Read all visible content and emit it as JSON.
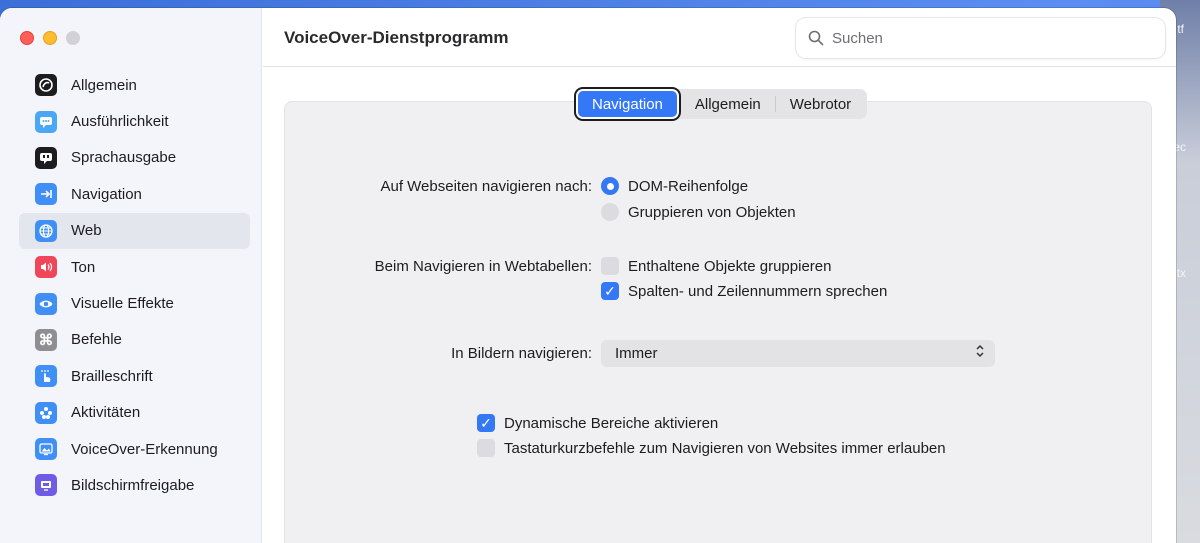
{
  "desktop": {
    "labels": [
      "tf",
      "ec",
      "tx"
    ]
  },
  "window": {
    "title": "VoiceOver-Dienstprogramm"
  },
  "search": {
    "placeholder": "Suchen"
  },
  "sidebar": {
    "items": [
      {
        "label": "Allgemein",
        "icon": "voiceover-icon",
        "color": "#1d1d1f"
      },
      {
        "label": "Ausführlichkeit",
        "icon": "speech-bubble-icon",
        "color": "#4aa7f5"
      },
      {
        "label": "Sprachausgabe",
        "icon": "speech-icon",
        "color": "#1d1d1f"
      },
      {
        "label": "Navigation",
        "icon": "arrow-right-icon",
        "color": "#3f8ff7"
      },
      {
        "label": "Web",
        "icon": "globe-icon",
        "color": "#3f8ff7",
        "selected": true
      },
      {
        "label": "Ton",
        "icon": "speaker-icon",
        "color": "#f0465a"
      },
      {
        "label": "Visuelle Effekte",
        "icon": "eye-icon",
        "color": "#3f8ff7"
      },
      {
        "label": "Befehle",
        "icon": "command-icon",
        "color": "#8e8e93"
      },
      {
        "label": "Brailleschrift",
        "icon": "braille-hand-icon",
        "color": "#3f8ff7"
      },
      {
        "label": "Aktivitäten",
        "icon": "activities-icon",
        "color": "#3f8ff7"
      },
      {
        "label": "VoiceOver-Erkennung",
        "icon": "recognition-icon",
        "color": "#3f8ff7"
      },
      {
        "label": "Bildschirmfreigabe",
        "icon": "screen-sharing-icon",
        "color": "#6e5ce6"
      }
    ]
  },
  "tabs": [
    {
      "label": "Navigation",
      "active": true
    },
    {
      "label": "Allgemein"
    },
    {
      "label": "Webrotor"
    }
  ],
  "settings": {
    "navigate_by_label": "Auf Webseiten navigieren nach:",
    "navigate_by_options": [
      {
        "label": "DOM-Reihenfolge",
        "selected": true
      },
      {
        "label": "Gruppieren von Objekten",
        "selected": false
      }
    ],
    "tables_label": "Beim Navigieren in Webtabellen:",
    "tables_options": [
      {
        "label": "Enthaltene Objekte gruppieren",
        "checked": false
      },
      {
        "label": "Spalten- und Zeilennummern sprechen",
        "checked": true
      }
    ],
    "images_label": "In Bildern navigieren:",
    "images_value": "Immer",
    "dynamic_regions": {
      "label": "Dynamische Bereiche aktivieren",
      "checked": true
    },
    "keyboard_shortcuts": {
      "label": "Tastaturkurzbefehle zum Navigieren von Websites immer erlauben",
      "checked": false
    }
  },
  "colors": {
    "accent": "#3478f6"
  }
}
